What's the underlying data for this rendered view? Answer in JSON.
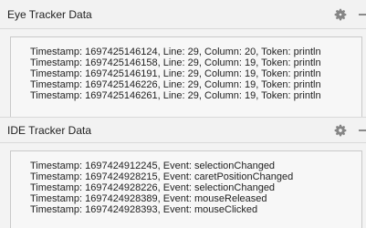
{
  "eye_panel": {
    "title": "Eye Tracker Data",
    "icons": [
      "gear-icon",
      "minimize-icon"
    ],
    "lines": [
      "Timestamp: 1697425146124, Line: 29, Column: 20, Token: println",
      "Timestamp: 1697425146158, Line: 29, Column: 19, Token: println",
      "Timestamp: 1697425146191, Line: 29, Column: 19, Token: println",
      "Timestamp: 1697425146226, Line: 29, Column: 19, Token: println",
      "Timestamp: 1697425146261, Line: 29, Column: 19, Token: println"
    ]
  },
  "ide_panel": {
    "title": "IDE Tracker Data",
    "icons": [
      "gear-icon",
      "minimize-icon"
    ],
    "lines": [
      "Timestamp: 1697424912245, Event: selectionChanged",
      "Timestamp: 1697424928215, Event: caretPositionChanged",
      "Timestamp: 1697424928226, Event: selectionChanged",
      "Timestamp: 1697424928389, Event: mouseReleased",
      "Timestamp: 1697424928393, Event: mouseClicked"
    ]
  }
}
